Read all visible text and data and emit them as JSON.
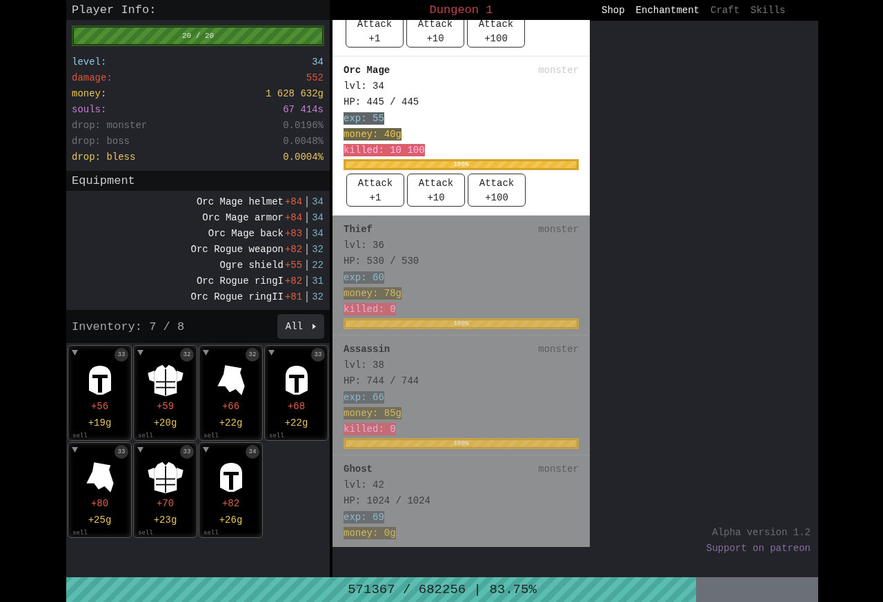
{
  "player": {
    "title": "Player Info:",
    "hp": {
      "text": "20 / 20",
      "level": 1
    },
    "stats": [
      {
        "label": "level:",
        "value": "34",
        "color": "#8fc7dd"
      },
      {
        "label": "damage:",
        "value": "552",
        "color": "#d9553b"
      },
      {
        "label": "money:",
        "value": "1 628 632g",
        "color": "#e8c65a"
      },
      {
        "label": "souls:",
        "value": "67 414s",
        "color": "#c77fd6"
      },
      {
        "label": "drop: monster",
        "value": "0.0196%",
        "color": "#707479"
      },
      {
        "label": "drop: boss",
        "value": "0.0048%",
        "color": "#707479"
      },
      {
        "label": "drop: bless",
        "value": "0.0004%",
        "color": "#e8c65a"
      }
    ]
  },
  "equipment": {
    "title": "Equipment",
    "items": [
      {
        "name": "Orc Mage helmet",
        "bonus": "+84",
        "level": "34"
      },
      {
        "name": "Orc Mage armor",
        "bonus": "+84",
        "level": "34"
      },
      {
        "name": "Orc Mage back",
        "bonus": "+83",
        "level": "34"
      },
      {
        "name": "Orc Rogue weapon",
        "bonus": "+82",
        "level": "32"
      },
      {
        "name": "Ogre shield",
        "bonus": "+55",
        "level": "22"
      },
      {
        "name": "Orc Rogue ringI",
        "bonus": "+82",
        "level": "31"
      },
      {
        "name": "Orc Rogue ringII",
        "bonus": "+81",
        "level": "32"
      }
    ]
  },
  "inventory": {
    "title": "Inventory: 7 / 8",
    "filter": "All",
    "items": [
      {
        "kind": "helmet",
        "level": "33",
        "bonus": "+56",
        "price": "+19g",
        "action": "sell"
      },
      {
        "kind": "armor",
        "level": "32",
        "bonus": "+59",
        "price": "+20g",
        "action": "sell"
      },
      {
        "kind": "cape",
        "level": "32",
        "bonus": "+66",
        "price": "+22g",
        "action": "sell"
      },
      {
        "kind": "helmet",
        "level": "33",
        "bonus": "+68",
        "price": "+22g",
        "action": "sell"
      },
      {
        "kind": "cape",
        "level": "33",
        "bonus": "+80",
        "price": "+25g",
        "action": "sell"
      },
      {
        "kind": "armor",
        "level": "33",
        "bonus": "+70",
        "price": "+23g",
        "action": "sell"
      },
      {
        "kind": "helmet",
        "level": "34",
        "bonus": "+82",
        "price": "+26g",
        "action": "sell"
      }
    ]
  },
  "dungeon": {
    "title": "Dungeon 1",
    "top_buttons": [
      {
        "label": "Attack",
        "amount": "+1"
      },
      {
        "label": "Attack",
        "amount": "+10"
      },
      {
        "label": "Attack",
        "amount": "+100"
      }
    ],
    "monsters": [
      {
        "name": "Orc Mage",
        "tag": "monster",
        "level": "lvl: 34",
        "hp": "HP: 445 / 445",
        "exp": "exp: 55",
        "money": "money: 40g",
        "killed": "killed: 10 100",
        "progress": {
          "text": "100%",
          "level": 1
        },
        "locked": false,
        "buttons": [
          {
            "label": "Attack",
            "amount": "+1"
          },
          {
            "label": "Attack",
            "amount": "+10"
          },
          {
            "label": "Attack",
            "amount": "+100"
          }
        ]
      },
      {
        "name": "Thief",
        "tag": "monster",
        "level": "lvl: 36",
        "hp": "HP: 530 / 530",
        "exp": "exp: 60",
        "money": "money: 78g",
        "killed": "killed: 0",
        "progress": {
          "text": "100%",
          "level": 1
        },
        "locked": true
      },
      {
        "name": "Assassin",
        "tag": "monster",
        "level": "lvl: 38",
        "hp": "HP: 744 / 744",
        "exp": "exp: 66",
        "money": "money: 85g",
        "killed": "killed: 0",
        "progress": {
          "text": "100%",
          "level": 1
        },
        "locked": true
      },
      {
        "name": "Ghost",
        "tag": "monster",
        "level": "lvl: 42",
        "hp": "HP: 1024 / 1024",
        "exp": "exp: 69",
        "money": "money: 0g",
        "locked": true
      }
    ]
  },
  "nav": {
    "tabs": [
      {
        "label": "Shop",
        "disabled": false
      },
      {
        "label": "Enchantment",
        "disabled": false
      },
      {
        "label": "Craft",
        "disabled": true
      },
      {
        "label": "Skills",
        "disabled": true
      }
    ]
  },
  "footer": {
    "version": "Alpha version 1.2",
    "support_link": "Support on patreon"
  },
  "experience_bar": {
    "text": "571367 / 682256 | 83.75%",
    "level": 0.8375
  }
}
